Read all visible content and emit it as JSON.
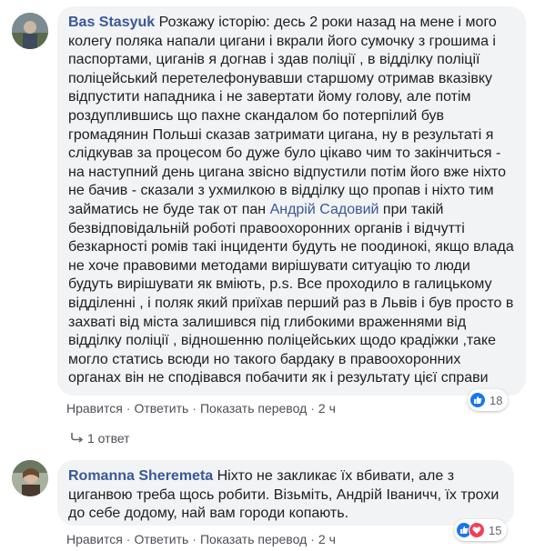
{
  "comments": [
    {
      "author": "Bas Stasyuk",
      "text_before": "Розкажу історію: десь 2 роки назад на мене і мого колегу поляка напали цигани і вкрали його сумочку з грошима і паспортами, циганів я догнав і здав поліції , в відділку поліції поліцейський перетелефонувавши старшому отримав вказівку відпустити нападника і не завертати йому голову, але потім роздуплившись що пахне скандалом бо потерпілий був громадянин Польші сказав затримати цигана, ну в результаті я слідкував за процесом бо дуже було цікаво чим то закінчиться - на наступний день цигана звісно відпустили потім його вже ніхто не бачив - сказали з ухмилкою в відділку що пропав і ніхто тим займатись не буде так от пан ",
      "mention": "Андрій Садовий",
      "text_after": " при такій безвідповідальній роботі правоохоронних органів і відчутті безкарності ромів такі інциденти будуть не поодинокі, якщо влада не хоче правовими методами вирішувати ситуацію то люди будуть вирішувати як вміють, p.s. Все проходило в галицькому відділенні , і поляк який приїхав перший раз в Львів і був просто в захваті від міста залишився під глибокими враженнями від відділку поліції , відношенню поліцейських щодо крадіжки ,таке могло статись всюди но такого бардаку в правоохоронних органах він не сподівався побачити як і результату цієї справи",
      "actions": {
        "like": "Нравится",
        "reply": "Ответить",
        "translate": "Показать перевод",
        "time": "2 ч"
      },
      "reaction_count": "18",
      "reply_count": "1 ответ"
    },
    {
      "author": "Romanna Sheremeta",
      "text": "Ніхто не закликає їх вбивати, але з циганвою треба щось робити. Візьміть, Андрій Іваничч, їх трохи до себе додому, най вам городи копають.",
      "actions": {
        "like": "Нравится",
        "reply": "Ответить",
        "translate": "Показать перевод",
        "time": "2 ч"
      },
      "reaction_count": "15"
    }
  ],
  "colors": {
    "link": "#385898",
    "bubble": "#f2f3f5",
    "like_blue": "#1877f2",
    "love_red": "#f33e58"
  },
  "icons": [
    "like-reaction-icon",
    "love-reaction-icon",
    "reply-arrow-icon"
  ]
}
